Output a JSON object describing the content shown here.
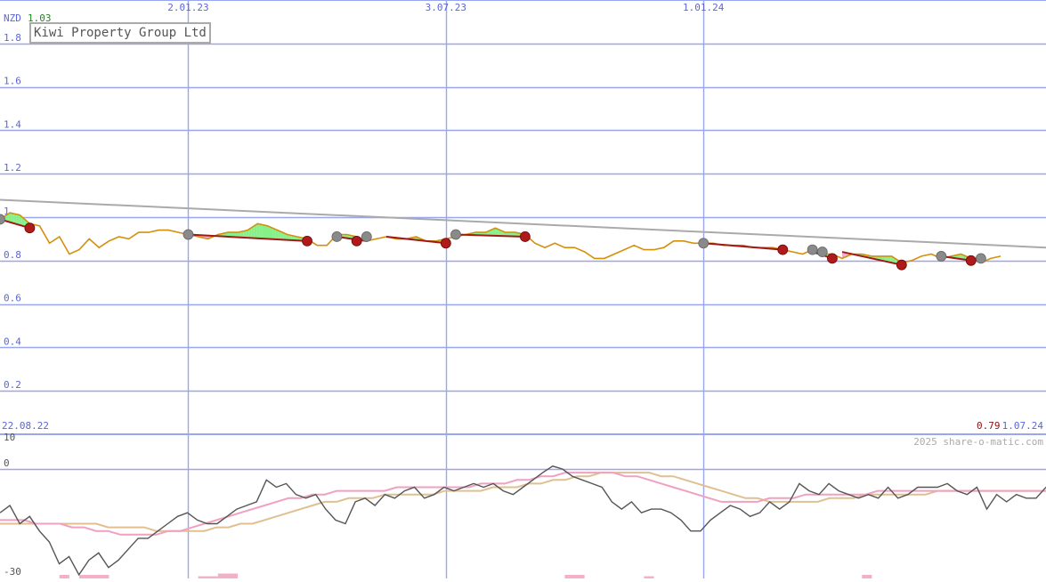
{
  "colors": {
    "grid": "#9aa6ee",
    "ytick_text": "#5a66d8",
    "price_line": "#d4900a",
    "trend_down": "#a01818",
    "trend_marker_low": "#b01a1a",
    "trend_marker_high": "#8a8a8a",
    "long_trend": "#aaaaaa",
    "area_up": "#88f088",
    "area_down": "#f4b0c8",
    "osc_main": "#555555",
    "osc_pink": "#f0a0c0",
    "osc_tan": "#e0c090",
    "vol_bar": "#f4b0c8",
    "current_value": "#8a1010",
    "nzd_label": "#5a66d8",
    "first_price": "#1a8a1a",
    "watermark": "#aaaaaa"
  },
  "header": {
    "currency": "NZD",
    "first_price": "1.03",
    "title": "Kiwi Property Group Ltd"
  },
  "footer": {
    "start_date": "22.08.22",
    "end_date": "1.07.24",
    "last_value": "0.79",
    "watermark": "2025 share-o-matic.com"
  },
  "chart_data": [
    {
      "type": "line",
      "title": "Kiwi Property Group Ltd",
      "ylabel": "NZD",
      "ylim": [
        0,
        2.0
      ],
      "yticks": [
        "0.2",
        "0.4",
        "0.6",
        "0.8",
        "1",
        "1.2",
        "1.4",
        "1.6",
        "1.8"
      ],
      "ytick_values": [
        0.2,
        0.4,
        0.6,
        0.8,
        1.0,
        1.2,
        1.4,
        1.6,
        1.8
      ],
      "xlim": [
        "2022-08-22",
        "2024-08-30"
      ],
      "xticks": [
        {
          "label": "2.01.23",
          "date": "2023-01-02"
        },
        {
          "label": "3.07.23",
          "date": "2023-07-03"
        },
        {
          "label": "1.01.24",
          "date": "2024-01-01"
        }
      ],
      "grid": true,
      "series": [
        {
          "role": "price",
          "points": [
            [
              "2022-08-22",
              0.99
            ],
            [
              "2022-08-29",
              1.02
            ],
            [
              "2022-09-05",
              1.01
            ],
            [
              "2022-09-12",
              0.97
            ],
            [
              "2022-09-19",
              0.96
            ],
            [
              "2022-09-26",
              0.88
            ],
            [
              "2022-10-03",
              0.91
            ],
            [
              "2022-10-10",
              0.83
            ],
            [
              "2022-10-17",
              0.85
            ],
            [
              "2022-10-24",
              0.9
            ],
            [
              "2022-10-31",
              0.86
            ],
            [
              "2022-11-07",
              0.89
            ],
            [
              "2022-11-14",
              0.91
            ],
            [
              "2022-11-21",
              0.9
            ],
            [
              "2022-11-28",
              0.93
            ],
            [
              "2022-12-05",
              0.93
            ],
            [
              "2022-12-12",
              0.94
            ],
            [
              "2022-12-19",
              0.94
            ],
            [
              "2022-12-26",
              0.93
            ],
            [
              "2023-01-02",
              0.92
            ],
            [
              "2023-01-09",
              0.91
            ],
            [
              "2023-01-16",
              0.9
            ],
            [
              "2023-01-23",
              0.92
            ],
            [
              "2023-01-30",
              0.93
            ],
            [
              "2023-02-06",
              0.93
            ],
            [
              "2023-02-13",
              0.94
            ],
            [
              "2023-02-20",
              0.97
            ],
            [
              "2023-02-27",
              0.96
            ],
            [
              "2023-03-06",
              0.94
            ],
            [
              "2023-03-13",
              0.92
            ],
            [
              "2023-03-20",
              0.91
            ],
            [
              "2023-03-27",
              0.9
            ],
            [
              "2023-04-03",
              0.87
            ],
            [
              "2023-04-10",
              0.87
            ],
            [
              "2023-04-17",
              0.92
            ],
            [
              "2023-04-24",
              0.92
            ],
            [
              "2023-05-01",
              0.91
            ],
            [
              "2023-05-08",
              0.89
            ],
            [
              "2023-05-15",
              0.9
            ],
            [
              "2023-05-22",
              0.91
            ],
            [
              "2023-05-29",
              0.9
            ],
            [
              "2023-06-05",
              0.9
            ],
            [
              "2023-06-12",
              0.91
            ],
            [
              "2023-06-19",
              0.89
            ],
            [
              "2023-06-26",
              0.89
            ],
            [
              "2023-07-03",
              0.9
            ],
            [
              "2023-07-10",
              0.91
            ],
            [
              "2023-07-17",
              0.92
            ],
            [
              "2023-07-24",
              0.93
            ],
            [
              "2023-07-31",
              0.93
            ],
            [
              "2023-08-07",
              0.95
            ],
            [
              "2023-08-14",
              0.93
            ],
            [
              "2023-08-21",
              0.93
            ],
            [
              "2023-08-28",
              0.92
            ],
            [
              "2023-09-04",
              0.88
            ],
            [
              "2023-09-11",
              0.86
            ],
            [
              "2023-09-18",
              0.88
            ],
            [
              "2023-09-25",
              0.86
            ],
            [
              "2023-10-02",
              0.86
            ],
            [
              "2023-10-09",
              0.84
            ],
            [
              "2023-10-16",
              0.81
            ],
            [
              "2023-10-23",
              0.81
            ],
            [
              "2023-10-30",
              0.83
            ],
            [
              "2023-11-06",
              0.85
            ],
            [
              "2023-11-13",
              0.87
            ],
            [
              "2023-11-20",
              0.85
            ],
            [
              "2023-11-27",
              0.85
            ],
            [
              "2023-12-04",
              0.86
            ],
            [
              "2023-12-11",
              0.89
            ],
            [
              "2023-12-18",
              0.89
            ],
            [
              "2023-12-25",
              0.88
            ],
            [
              "2024-01-01",
              0.88
            ],
            [
              "2024-01-08",
              0.88
            ],
            [
              "2024-01-15",
              0.87
            ],
            [
              "2024-01-22",
              0.87
            ],
            [
              "2024-01-29",
              0.87
            ],
            [
              "2024-02-05",
              0.86
            ],
            [
              "2024-02-12",
              0.86
            ],
            [
              "2024-02-19",
              0.86
            ],
            [
              "2024-02-26",
              0.85
            ],
            [
              "2024-03-04",
              0.84
            ],
            [
              "2024-03-11",
              0.83
            ],
            [
              "2024-03-18",
              0.85
            ],
            [
              "2024-03-25",
              0.83
            ],
            [
              "2024-04-01",
              0.83
            ],
            [
              "2024-04-08",
              0.81
            ],
            [
              "2024-04-15",
              0.83
            ],
            [
              "2024-04-22",
              0.83
            ],
            [
              "2024-04-29",
              0.82
            ],
            [
              "2024-05-06",
              0.82
            ],
            [
              "2024-05-13",
              0.82
            ],
            [
              "2024-05-20",
              0.79
            ],
            [
              "2024-05-27",
              0.8
            ],
            [
              "2024-06-03",
              0.82
            ],
            [
              "2024-06-10",
              0.83
            ],
            [
              "2024-06-17",
              0.81
            ],
            [
              "2024-06-24",
              0.82
            ],
            [
              "2024-07-01",
              0.83
            ],
            [
              "2024-07-08",
              0.81
            ],
            [
              "2024-07-15",
              0.79
            ],
            [
              "2024-07-22",
              0.81
            ],
            [
              "2024-07-29",
              0.82
            ]
          ]
        },
        {
          "role": "long-trend",
          "points": [
            [
              "2022-08-22",
              1.08
            ],
            [
              "2024-08-30",
              0.86
            ]
          ]
        },
        {
          "role": "trend-segments",
          "segments": [
            [
              [
                "2022-08-22",
                0.99
              ],
              [
                "2022-09-12",
                0.95
              ]
            ],
            [
              [
                "2023-01-02",
                0.92
              ],
              [
                "2023-03-27",
                0.89
              ]
            ],
            [
              [
                "2023-04-17",
                0.91
              ],
              [
                "2023-05-08",
                0.89
              ]
            ],
            [
              [
                "2023-05-22",
                0.91
              ],
              [
                "2023-07-03",
                0.88
              ]
            ],
            [
              [
                "2023-07-10",
                0.92
              ],
              [
                "2023-08-28",
                0.91
              ]
            ],
            [
              [
                "2024-01-01",
                0.88
              ],
              [
                "2024-02-26",
                0.85
              ]
            ],
            [
              [
                "2024-03-18",
                0.84
              ],
              [
                "2024-04-01",
                0.81
              ]
            ],
            [
              [
                "2024-04-08",
                0.84
              ],
              [
                "2024-05-20",
                0.78
              ]
            ],
            [
              [
                "2024-06-17",
                0.82
              ],
              [
                "2024-07-08",
                0.8
              ]
            ]
          ],
          "markers_high": [
            [
              "2022-08-22",
              0.99
            ],
            [
              "2023-01-02",
              0.92
            ],
            [
              "2023-04-17",
              0.91
            ],
            [
              "2023-05-08",
              0.91
            ],
            [
              "2023-07-10",
              0.92
            ],
            [
              "2024-01-01",
              0.88
            ],
            [
              "2024-03-18",
              0.85
            ],
            [
              "2024-03-25",
              0.84
            ],
            [
              "2024-06-17",
              0.82
            ],
            [
              "2024-07-15",
              0.81
            ]
          ],
          "markers_low": [
            [
              "2022-09-12",
              0.95
            ],
            [
              "2023-03-27",
              0.89
            ],
            [
              "2023-05-01",
              0.89
            ],
            [
              "2023-07-03",
              0.88
            ],
            [
              "2023-08-28",
              0.91
            ],
            [
              "2024-02-26",
              0.85
            ],
            [
              "2024-04-01",
              0.81
            ],
            [
              "2024-05-20",
              0.78
            ],
            [
              "2024-07-08",
              0.8
            ]
          ]
        }
      ]
    },
    {
      "type": "line",
      "role": "oscillator",
      "ylim": [
        -30,
        10
      ],
      "yticks": [
        "10",
        "0",
        "-30"
      ],
      "ytick_values": [
        10,
        0,
        -30
      ],
      "grid": true,
      "series": [
        {
          "role": "oscillator-main",
          "values": [
            -12,
            -10,
            -15,
            -13,
            -17,
            -20,
            -26,
            -24,
            -29,
            -25,
            -23,
            -27,
            -25,
            -22,
            -19,
            -19,
            -17,
            -15,
            -13,
            -12,
            -14,
            -15,
            -15,
            -13,
            -11,
            -10,
            -9,
            -3,
            -5,
            -4,
            -7,
            -8,
            -7,
            -11,
            -14,
            -15,
            -9,
            -8,
            -10,
            -7,
            -8,
            -6,
            -5,
            -8,
            -7,
            -5,
            -6,
            -5,
            -4,
            -5,
            -4,
            -6,
            -7,
            -5,
            -3,
            -1,
            1,
            0,
            -2,
            -3,
            -4,
            -5,
            -9,
            -11,
            -9,
            -12,
            -11,
            -11,
            -12,
            -14,
            -17,
            -17,
            -14,
            -12,
            -10,
            -11,
            -13,
            -12,
            -9,
            -11,
            -9,
            -4,
            -6,
            -7,
            -4,
            -6,
            -7,
            -8,
            -7,
            -8,
            -5,
            -8,
            -7,
            -5,
            -5,
            -5,
            -4,
            -6,
            -7,
            -5,
            -11,
            -7,
            -9,
            -7,
            -8,
            -8,
            -5
          ]
        },
        {
          "role": "signal-pink",
          "values": [
            -14,
            -14,
            -14,
            -15,
            -15,
            -15,
            -16,
            -16,
            -17,
            -17,
            -18,
            -18,
            -18,
            -18,
            -17,
            -17,
            -16,
            -15,
            -14,
            -13,
            -12,
            -11,
            -10,
            -9,
            -8,
            -8,
            -7,
            -7,
            -6,
            -6,
            -6,
            -6,
            -6,
            -5,
            -5,
            -5,
            -5,
            -5,
            -5,
            -5,
            -4,
            -4,
            -4,
            -3,
            -3,
            -2,
            -2,
            -1,
            -1,
            -1,
            -1,
            -1,
            -2,
            -2,
            -3,
            -4,
            -5,
            -6,
            -7,
            -8,
            -9,
            -9,
            -9,
            -9,
            -8,
            -8,
            -8,
            -7,
            -7,
            -7,
            -7,
            -7,
            -7,
            -6,
            -6,
            -6,
            -6,
            -6,
            -6,
            -6,
            -6,
            -6,
            -6,
            -6,
            -6,
            -6,
            -6,
            -6
          ]
        },
        {
          "role": "signal-tan",
          "values": [
            -15,
            -15,
            -15,
            -15,
            -15,
            -15,
            -15,
            -15,
            -15,
            -16,
            -16,
            -16,
            -16,
            -17,
            -17,
            -17,
            -17,
            -17,
            -16,
            -16,
            -15,
            -15,
            -14,
            -13,
            -12,
            -11,
            -10,
            -9,
            -9,
            -8,
            -8,
            -8,
            -7,
            -7,
            -7,
            -7,
            -7,
            -6,
            -6,
            -6,
            -6,
            -5,
            -5,
            -5,
            -4,
            -4,
            -3,
            -3,
            -2,
            -2,
            -1,
            -1,
            -1,
            -1,
            -1,
            -2,
            -2,
            -3,
            -4,
            -5,
            -6,
            -7,
            -8,
            -8,
            -9,
            -9,
            -9,
            -9,
            -9,
            -8,
            -8,
            -8,
            -7,
            -7,
            -7,
            -7,
            -7,
            -7,
            -6,
            -6,
            -6,
            -6,
            -6,
            -6,
            -6,
            -6,
            -6,
            -6
          ]
        }
      ],
      "volume_bars": [
        {
          "start": "2022-10-03",
          "end": "2022-10-10",
          "level": 2
        },
        {
          "start": "2022-10-17",
          "end": "2022-11-07",
          "level": 2
        },
        {
          "start": "2023-01-09",
          "end": "2023-01-23",
          "level": 1
        },
        {
          "start": "2023-01-23",
          "end": "2023-02-06",
          "level": 3
        },
        {
          "start": "2023-09-25",
          "end": "2023-10-09",
          "level": 2
        },
        {
          "start": "2023-11-20",
          "end": "2023-11-27",
          "level": 1
        },
        {
          "start": "2024-04-22",
          "end": "2024-04-29",
          "level": 2
        }
      ]
    }
  ]
}
